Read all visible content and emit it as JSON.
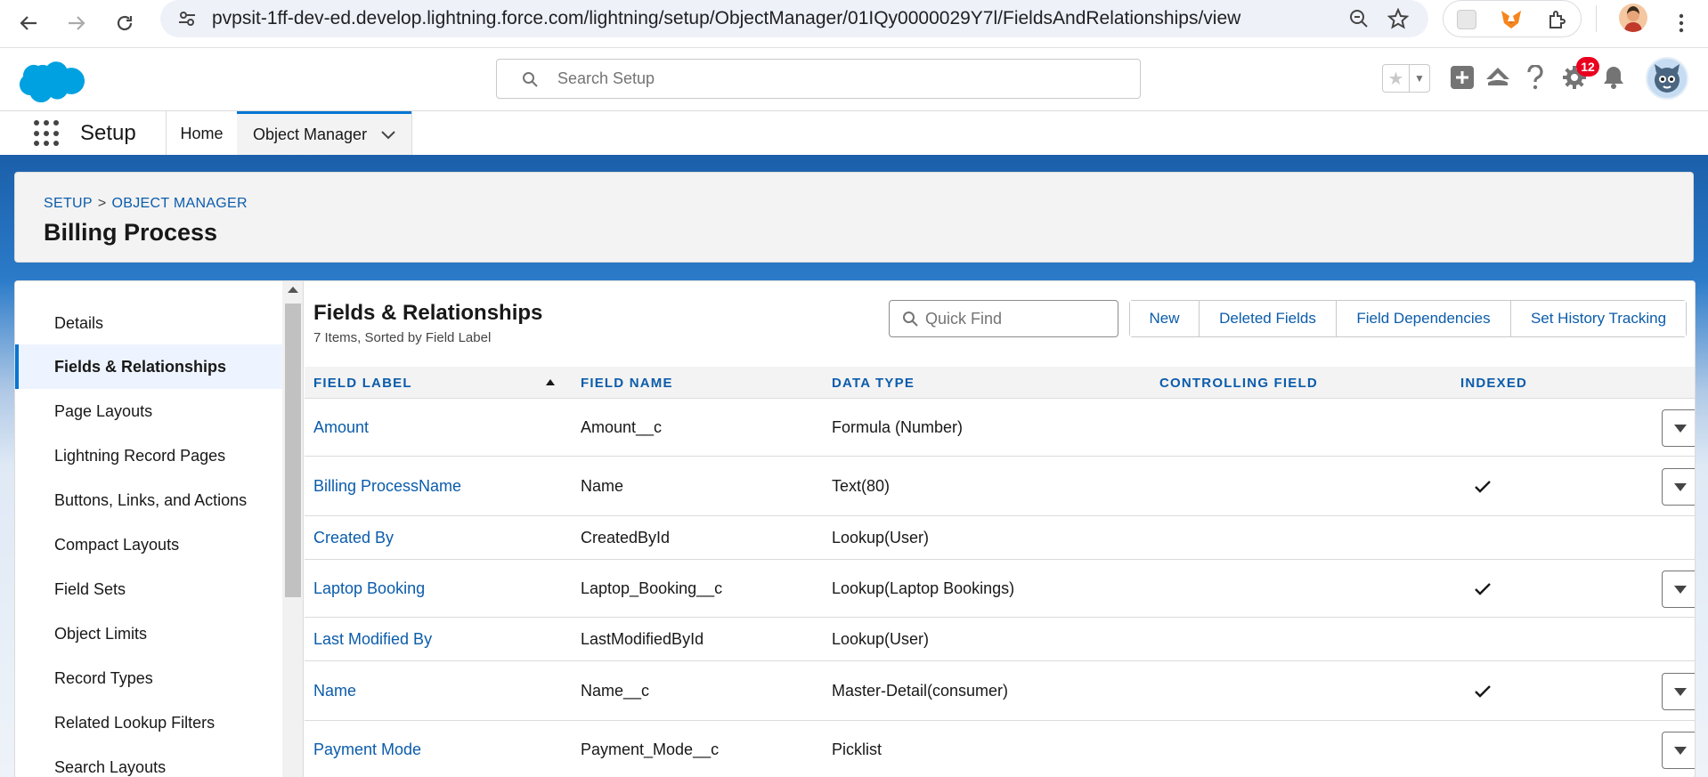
{
  "browser": {
    "url": "pvpsit-1ff-dev-ed.develop.lightning.force.com/lightning/setup/ObjectManager/01IQy0000029Y7l/FieldsAndRelationships/view"
  },
  "header": {
    "search_placeholder": "Search Setup",
    "notification_count": "12"
  },
  "app_nav": {
    "app_name": "Setup",
    "tabs": [
      {
        "label": "Home"
      },
      {
        "label": "Object Manager"
      }
    ]
  },
  "page_header": {
    "breadcrumb": {
      "setup": "SETUP",
      "separator": ">",
      "object_manager": "OBJECT MANAGER"
    },
    "title": "Billing Process"
  },
  "sidebar": {
    "items": [
      {
        "label": "Details"
      },
      {
        "label": "Fields & Relationships"
      },
      {
        "label": "Page Layouts"
      },
      {
        "label": "Lightning Record Pages"
      },
      {
        "label": "Buttons, Links, and Actions"
      },
      {
        "label": "Compact Layouts"
      },
      {
        "label": "Field Sets"
      },
      {
        "label": "Object Limits"
      },
      {
        "label": "Record Types"
      },
      {
        "label": "Related Lookup Filters"
      },
      {
        "label": "Search Layouts"
      }
    ]
  },
  "panel": {
    "title": "Fields & Relationships",
    "subtitle": "7 Items, Sorted by Field Label",
    "quick_find_placeholder": "Quick Find",
    "buttons": {
      "new": "New",
      "deleted_fields": "Deleted Fields",
      "field_dependencies": "Field Dependencies",
      "set_history_tracking": "Set History Tracking"
    }
  },
  "table": {
    "columns": {
      "field_label": "FIELD LABEL",
      "field_name": "FIELD NAME",
      "data_type": "DATA TYPE",
      "controlling_field": "CONTROLLING FIELD",
      "indexed": "INDEXED"
    },
    "rows": [
      {
        "field_label": "Amount",
        "field_name": "Amount__c",
        "data_type": "Formula (Number)",
        "controlling_field": "",
        "indexed": false,
        "has_menu": true
      },
      {
        "field_label": "Billing ProcessName",
        "field_name": "Name",
        "data_type": "Text(80)",
        "controlling_field": "",
        "indexed": true,
        "has_menu": true
      },
      {
        "field_label": "Created By",
        "field_name": "CreatedById",
        "data_type": "Lookup(User)",
        "controlling_field": "",
        "indexed": false,
        "has_menu": false
      },
      {
        "field_label": "Laptop Booking",
        "field_name": "Laptop_Booking__c",
        "data_type": "Lookup(Laptop Bookings)",
        "controlling_field": "",
        "indexed": true,
        "has_menu": true
      },
      {
        "field_label": "Last Modified By",
        "field_name": "LastModifiedById",
        "data_type": "Lookup(User)",
        "controlling_field": "",
        "indexed": false,
        "has_menu": false
      },
      {
        "field_label": "Name",
        "field_name": "Name__c",
        "data_type": "Master-Detail(consumer)",
        "controlling_field": "",
        "indexed": true,
        "has_menu": true
      },
      {
        "field_label": "Payment Mode",
        "field_name": "Payment_Mode__c",
        "data_type": "Picklist",
        "controlling_field": "",
        "indexed": false,
        "has_menu": true
      }
    ]
  },
  "colors": {
    "brand_blue": "#0176d3",
    "link_blue": "#0b5cab",
    "notification_red": "#ea001e"
  }
}
